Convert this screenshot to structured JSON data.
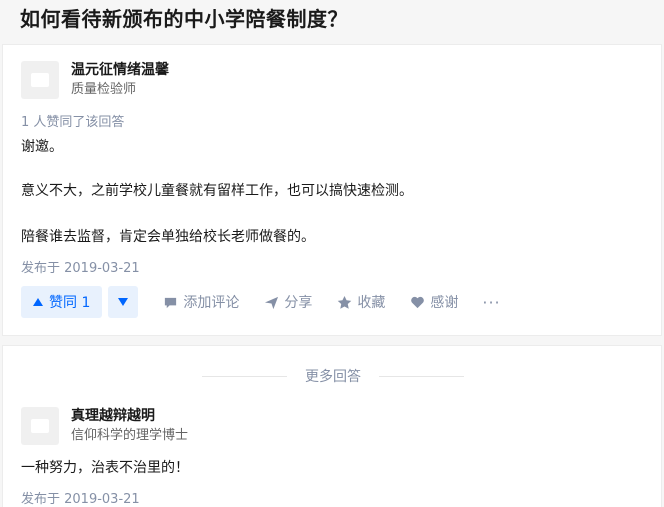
{
  "question": {
    "title": "如何看待新颁布的中小学陪餐制度？"
  },
  "answers": [
    {
      "author_name": "温元征情绪温馨",
      "author_title": "质量检验师",
      "vote_summary": "1 人赞同了该回答",
      "paragraphs": [
        "谢邀。",
        "意义不大，之前学校儿童餐就有留样工作，也可以搞快速检测。",
        "陪餐谁去监督，肯定会单独给校长老师做餐的。"
      ],
      "date": "发布于 2019-03-21"
    },
    {
      "author_name": "真理越辩越明",
      "author_title": "信仰科学的理学博士",
      "paragraphs": [
        "一种努力，治表不治里的！"
      ],
      "date": "发布于 2019-03-21"
    }
  ],
  "actions": {
    "upvote_label": "赞同 1",
    "comment_label": "添加评论",
    "share_label": "分享",
    "favorite_label": "收藏",
    "thanks_label": "感谢",
    "more_label": "···"
  },
  "more_answers_label": "更多回答",
  "colors": {
    "accent": "#0066ff",
    "muted": "#8590a6",
    "upvote_bg": "#e8f1fd"
  }
}
